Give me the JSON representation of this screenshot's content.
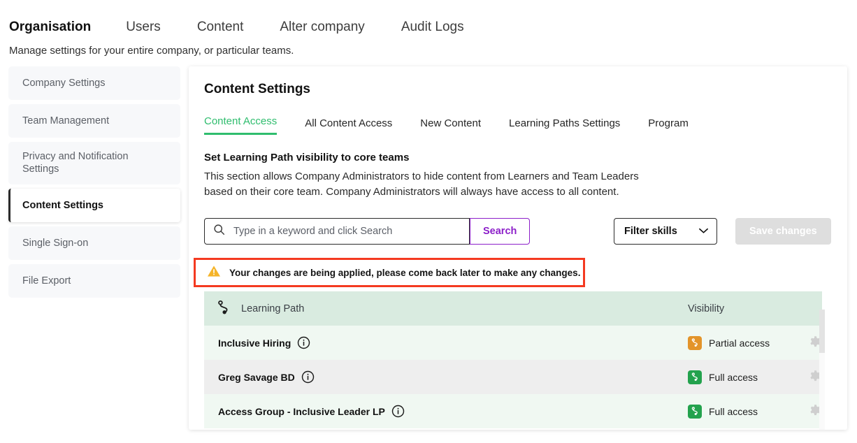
{
  "topnav": {
    "items": [
      {
        "label": "Organisation",
        "active": true
      },
      {
        "label": "Users",
        "active": false
      },
      {
        "label": "Content",
        "active": false
      },
      {
        "label": "Alter company",
        "active": false
      },
      {
        "label": "Audit Logs",
        "active": false
      }
    ],
    "subtitle": "Manage settings for your entire company, or particular teams."
  },
  "sidebar": {
    "items": [
      {
        "label": "Company Settings"
      },
      {
        "label": "Team Management"
      },
      {
        "label": "Privacy and Notification Settings"
      },
      {
        "label": "Content Settings"
      },
      {
        "label": "Single Sign-on"
      },
      {
        "label": "File Export"
      }
    ]
  },
  "card": {
    "title": "Content Settings",
    "tabs": [
      {
        "label": "Content Access",
        "active": true
      },
      {
        "label": "All Content Access",
        "active": false
      },
      {
        "label": "New Content",
        "active": false
      },
      {
        "label": "Learning Paths Settings",
        "active": false
      },
      {
        "label": "Program",
        "active": false
      }
    ],
    "section": {
      "heading": "Set Learning Path visibility to core teams",
      "description": "This section allows Company Administrators to hide content from Learners and Team Leaders based on their core team. Company Administrators will always have access to all content."
    },
    "controls": {
      "search_placeholder": "Type in a keyword and click Search",
      "search_value": "",
      "search_button": "Search",
      "filter_label": "Filter skills",
      "save_button": "Save changes",
      "save_disabled": true
    },
    "warning": {
      "text": "Your changes are being applied, please come back later to make any changes.",
      "border_color": "#f43a21",
      "icon_color": "#f5b429"
    },
    "table": {
      "columns": [
        "Learning Path",
        "Visibility"
      ],
      "rows": [
        {
          "name": "Inclusive Hiring",
          "visibility": "Partial access",
          "badge_color": "#e3942a"
        },
        {
          "name": "Greg Savage BD",
          "visibility": "Full access",
          "badge_color": "#23a24d"
        },
        {
          "name": "Access Group - Inclusive Leader LP",
          "visibility": "Full access",
          "badge_color": "#23a24d"
        }
      ]
    }
  },
  "colors": {
    "accent_green": "#2fbd6e",
    "accent_purple": "#8c1fc9",
    "header_green": "#d9ebe0"
  }
}
